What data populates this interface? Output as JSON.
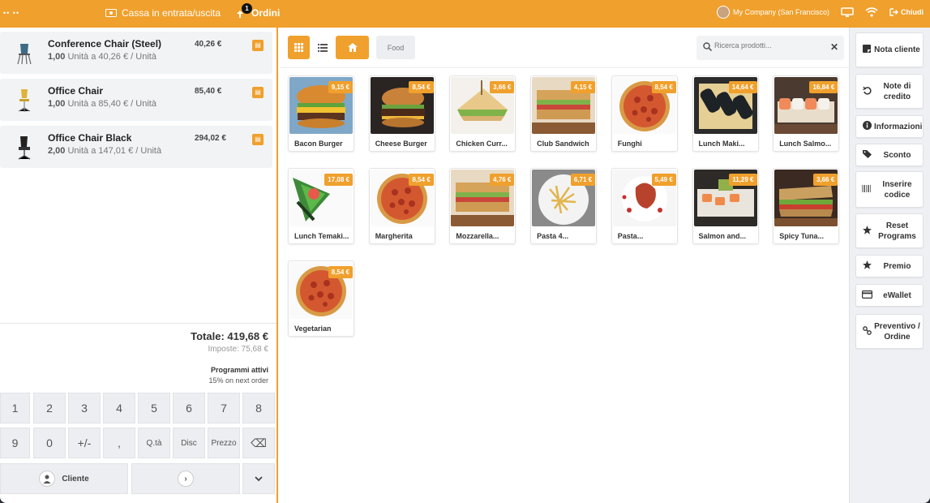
{
  "topbar": {
    "menu_dots": "•• ••",
    "cash_label": "Cassa in entrata/uscita",
    "orders_label": "Ordini",
    "orders_count": "1",
    "company": "My Company (San Francisco)",
    "close_label": "Chiudi"
  },
  "order": {
    "lines": [
      {
        "name": "Conference Chair (Steel)",
        "qty": "1,00",
        "unit_text": "Unità a 40,26 € / Unità",
        "price": "40,26 €"
      },
      {
        "name": "Office Chair",
        "qty": "1,00",
        "unit_text": "Unità a 85,40 € / Unità",
        "price": "85,40 €"
      },
      {
        "name": "Office Chair Black",
        "qty": "2,00",
        "unit_text": "Unità a 147,01 € / Unità",
        "price": "294,02 €"
      }
    ],
    "total": "Totale: 419,68 €",
    "taxes": "Imposte: 75,68 €",
    "programs_title": "Programmi attivi",
    "program_item": "15% on next order"
  },
  "numpad": {
    "row1": [
      "1",
      "2",
      "3",
      "4",
      "5",
      "6",
      "7",
      "8"
    ],
    "row2": [
      "9",
      "0",
      "+/-",
      ",",
      "Q.tà",
      "Disc",
      "Prezzo",
      "⌫"
    ],
    "customer_label": "Cliente",
    "next_icon": "chevron-right-icon",
    "more_icon": "chevron-down-icon"
  },
  "products_bar": {
    "category": "Food",
    "search_placeholder": "Ricerca prodotti..."
  },
  "products": [
    {
      "name": "Bacon Burger",
      "price": "9,15 €",
      "img": "burger"
    },
    {
      "name": "Cheese Burger",
      "price": "8,54 €",
      "img": "burger-dark"
    },
    {
      "name": "Chicken Curr...",
      "price": "3,66 €",
      "img": "sandwich"
    },
    {
      "name": "Club Sandwich",
      "price": "4,15 €",
      "img": "club"
    },
    {
      "name": "Funghi",
      "price": "8,54 €",
      "img": "pizza"
    },
    {
      "name": "Lunch Maki...",
      "price": "14,64 €",
      "img": "maki"
    },
    {
      "name": "Lunch Salmo...",
      "price": "16,84 €",
      "img": "salmon"
    },
    {
      "name": "Lunch Temaki...",
      "price": "17,08 €",
      "img": "temaki"
    },
    {
      "name": "Margherita",
      "price": "8,54 €",
      "img": "pizza"
    },
    {
      "name": "Mozzarella...",
      "price": "4,76 €",
      "img": "club"
    },
    {
      "name": "Pasta 4...",
      "price": "6,71 €",
      "img": "pasta"
    },
    {
      "name": "Pasta...",
      "price": "5,49 €",
      "img": "pasta-red"
    },
    {
      "name": "Salmon and...",
      "price": "11,29 €",
      "img": "salmon-av"
    },
    {
      "name": "Spicy Tuna...",
      "price": "3,66 €",
      "img": "spicy"
    },
    {
      "name": "Vegetarian",
      "price": "8,54 €",
      "img": "pizza"
    }
  ],
  "actions": [
    {
      "label": "Nota cliente",
      "icon": "note-icon"
    },
    {
      "label": "Note di credito",
      "icon": "undo-icon"
    },
    {
      "label": "Informazioni",
      "icon": "info-icon"
    },
    {
      "label": "Sconto",
      "icon": "tag-icon"
    },
    {
      "label": "Inserire codice",
      "icon": "barcode-icon"
    },
    {
      "label": "Reset Programs",
      "icon": "star-icon"
    },
    {
      "label": "Premio",
      "icon": "star-icon"
    },
    {
      "label": "eWallet",
      "icon": "card-icon"
    },
    {
      "label": "Preventivo / Ordine",
      "icon": "link-icon"
    }
  ],
  "colors": {
    "accent": "#f0a02c",
    "panel": "#eef0f3"
  }
}
